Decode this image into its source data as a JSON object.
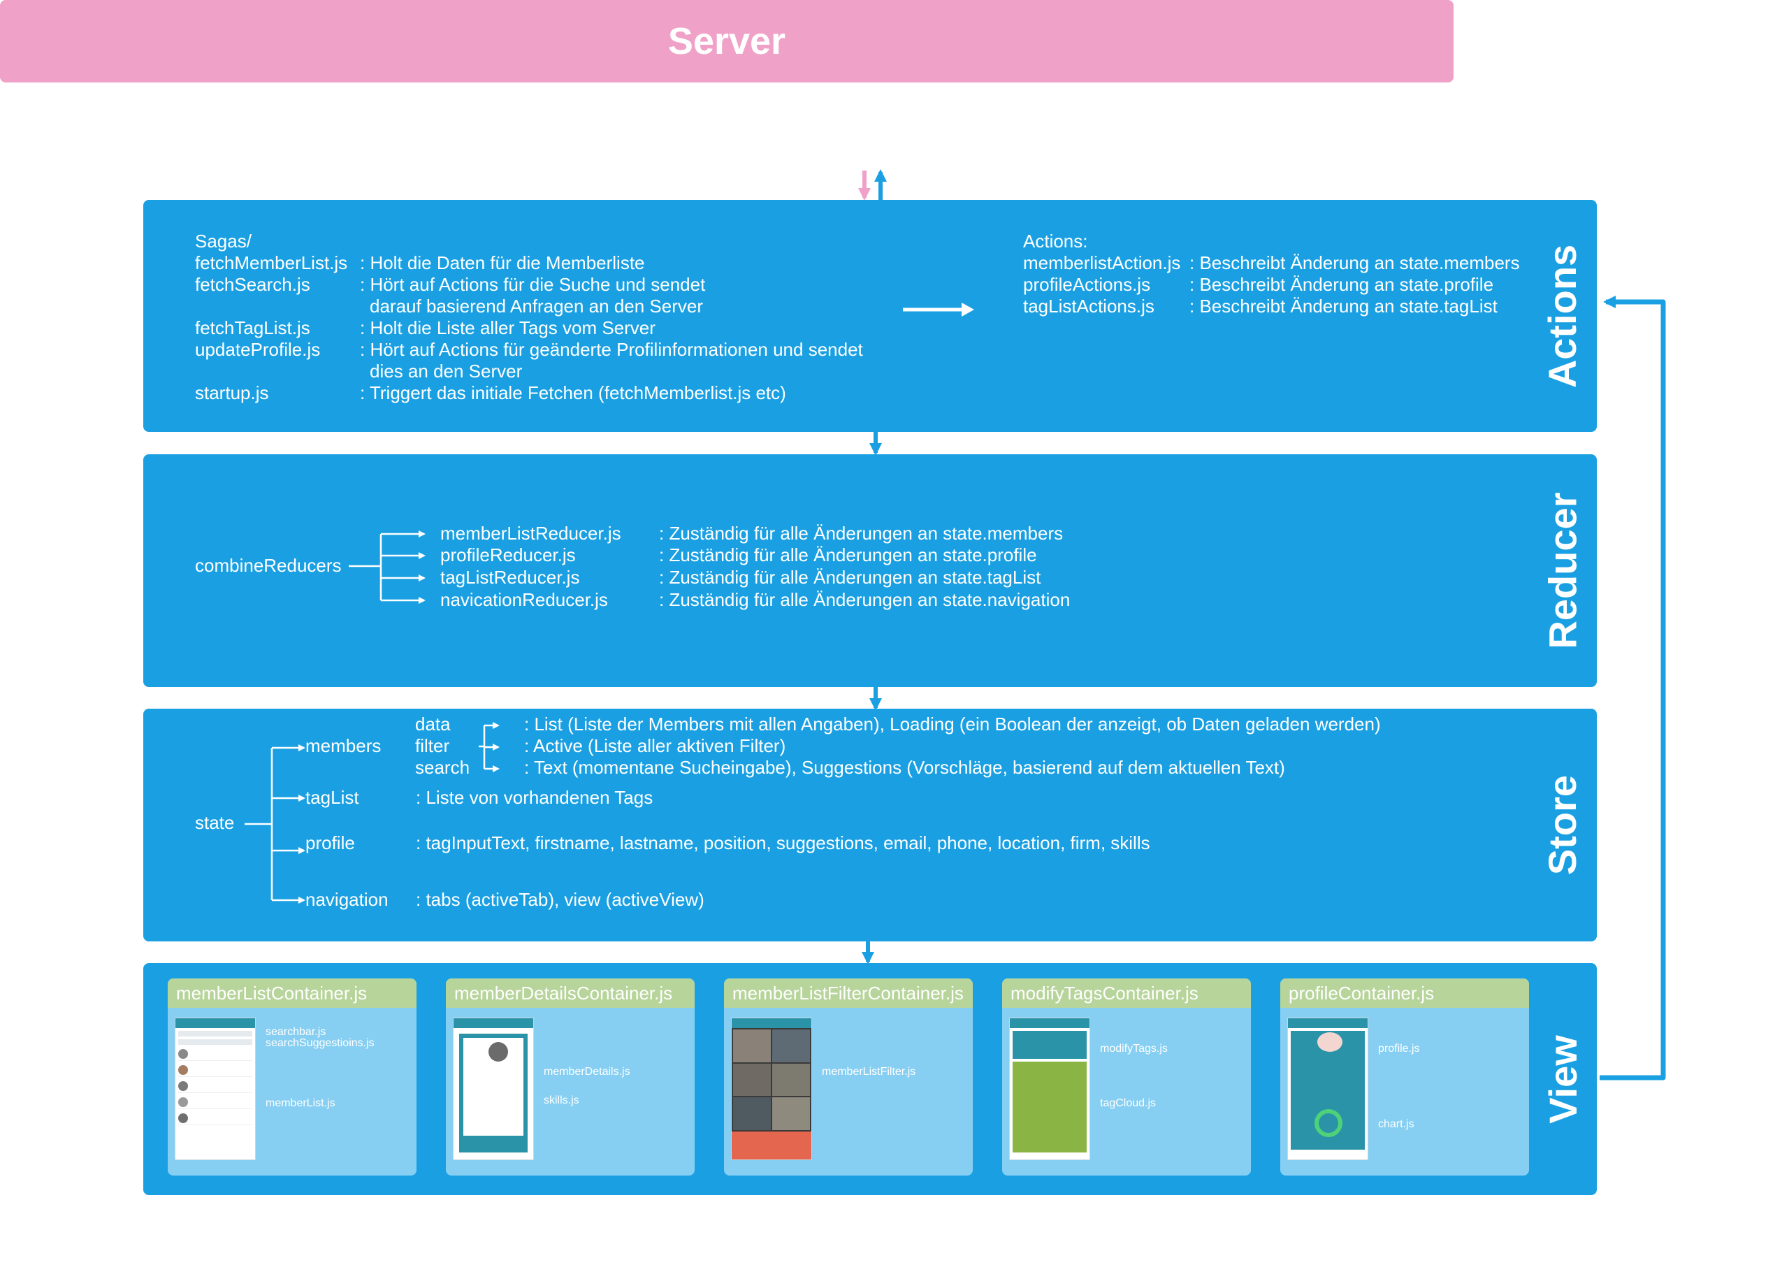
{
  "server": {
    "title": "Server"
  },
  "actions": {
    "side_label": "Actions",
    "sagas_header": "Sagas/",
    "sagas": [
      {
        "file": "fetchMemberList.js",
        "desc": ": Holt die Daten für die Memberliste"
      },
      {
        "file": "fetchSearch.js",
        "desc": ": Hört auf Actions für die Suche und sendet"
      },
      {
        "file": "",
        "desc": "darauf basierend Anfragen an den Server"
      },
      {
        "file": "fetchTagList.js",
        "desc": ": Holt die Liste aller Tags vom Server"
      },
      {
        "file": "updateProfile.js",
        "desc": ": Hört auf Actions für geänderte Profilinformationen und sendet"
      },
      {
        "file": "",
        "desc": "dies an den Server"
      },
      {
        "file": "startup.js",
        "desc": ": Triggert das initiale Fetchen (fetchMemberlist.js etc)"
      }
    ],
    "actions_header": "Actions:",
    "actions": [
      {
        "file": "memberlistAction.js",
        "desc": ": Beschreibt Änderung an state.members"
      },
      {
        "file": "profileActions.js",
        "desc": ": Beschreibt Änderung an state.profile"
      },
      {
        "file": "tagListActions.js",
        "desc": ": Beschreibt Änderung an state.tagList"
      }
    ]
  },
  "reducer": {
    "side_label": "Reducer",
    "root": "combineReducers",
    "items": [
      {
        "file": "memberListReducer.js",
        "desc": ": Zuständig für alle Änderungen an state.members"
      },
      {
        "file": "profileReducer.js",
        "desc": ": Zuständig für alle Änderungen an state.profile"
      },
      {
        "file": "tagListReducer.js",
        "desc": ": Zuständig für alle Änderungen an state.tagList"
      },
      {
        "file": "navicationReducer.js",
        "desc": ": Zuständig für alle Änderungen an state.navigation"
      }
    ]
  },
  "store": {
    "side_label": "Store",
    "root": "state",
    "members": {
      "label": "members",
      "children": [
        {
          "key": "data",
          "desc": ": List (Liste der Members mit allen Angaben), Loading (ein Boolean der anzeigt, ob Daten geladen werden)"
        },
        {
          "key": "filter",
          "desc": ": Active (Liste aller aktiven Filter)"
        },
        {
          "key": "search",
          "desc": ": Text (momentane Sucheingabe), Suggestions (Vorschläge, basierend auf dem aktuellen Text)"
        }
      ]
    },
    "tagList": {
      "label": "tagList",
      "desc": ": Liste von vorhandenen Tags"
    },
    "profile": {
      "label": "profile",
      "desc": ": tagInputText, firstname, lastname, position, suggestions, email, phone, location, firm, skills"
    },
    "navigation": {
      "label": "navigation",
      "desc": ": tabs (activeTab), view (activeView)"
    }
  },
  "view": {
    "side_label": "View",
    "containers": [
      {
        "title": "memberListContainer.js",
        "labels": [
          "searchbar.js",
          "searchSuggestioins.js",
          "memberList.js"
        ]
      },
      {
        "title": "memberDetailsContainer.js",
        "labels": [
          "memberDetails.js",
          "skills.js"
        ]
      },
      {
        "title": "memberListFilterContainer.js",
        "labels": [
          "memberListFilter.js"
        ]
      },
      {
        "title": "modifyTagsContainer.js",
        "labels": [
          "modifyTags.js",
          "tagCloud.js"
        ]
      },
      {
        "title": "profileContainer.js",
        "labels": [
          "profile.js",
          "chart.js"
        ]
      }
    ]
  },
  "colors": {
    "server": "#f0a1c8",
    "panel": "#1aa0e2",
    "card": "#86cff2",
    "card_header": "#b7d49b"
  }
}
